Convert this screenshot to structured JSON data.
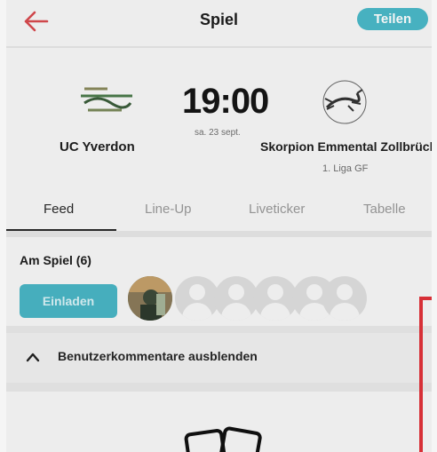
{
  "header": {
    "title": "Spiel",
    "share_label": "Teilen",
    "back_icon": "arrow-left-icon",
    "accent_color": "#e0323a",
    "share_color": "#4ab9c8"
  },
  "match": {
    "home_team": "UC Yverdon",
    "away_team": "Skorpion Emmental Zollbrück",
    "time": "19:00",
    "date": "sa. 23 sept.",
    "league": "1. Liga GF"
  },
  "tabs": [
    {
      "label": "Feed",
      "active": true
    },
    {
      "label": "Line-Up",
      "active": false
    },
    {
      "label": "Liveticker",
      "active": false
    },
    {
      "label": "Tabelle",
      "active": false
    }
  ],
  "attendance": {
    "label": "Am Spiel (6)",
    "invite_label": "Einladen"
  },
  "comments": {
    "toggle_label": "Benutzerkommentare ausblenden",
    "icon": "chevron-up-icon"
  }
}
